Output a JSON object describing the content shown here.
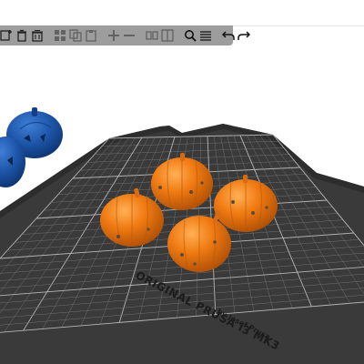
{
  "window": {
    "title": ""
  },
  "toolbar": {
    "items": [
      {
        "name": "add-icon",
        "enabled": true
      },
      {
        "name": "delete-icon",
        "enabled": true
      },
      {
        "name": "delete-all-icon",
        "enabled": true
      },
      {
        "name": "arrange-icon",
        "enabled": false
      },
      {
        "name": "copy-icon",
        "enabled": false
      },
      {
        "name": "paste-icon",
        "enabled": false
      },
      {
        "name": "add-instance-icon",
        "enabled": false
      },
      {
        "name": "remove-instance-icon",
        "enabled": false
      },
      {
        "name": "split-objects-icon",
        "enabled": false
      },
      {
        "name": "split-parts-icon",
        "enabled": false
      },
      {
        "name": "search-icon",
        "enabled": true
      },
      {
        "name": "layers-editing-icon",
        "enabled": true
      },
      {
        "name": "undo-icon",
        "enabled": true
      },
      {
        "name": "redo-icon",
        "enabled": true
      }
    ]
  },
  "bed": {
    "label_line1": "ORIGINAL PRUSA i3 MK3",
    "label_line2": "by Josef Prusa"
  },
  "scene": {
    "objects": [
      {
        "name": "pumpkin-1",
        "state": "selected",
        "color": "#f07a12"
      },
      {
        "name": "pumpkin-2",
        "state": "selected",
        "color": "#f07a12"
      },
      {
        "name": "pumpkin-3",
        "state": "selected",
        "color": "#f07a12"
      },
      {
        "name": "pumpkin-4",
        "state": "selected",
        "color": "#f07a12"
      },
      {
        "name": "pumpkin-outside-1",
        "state": "outside-bed",
        "color": "#1d55a8"
      },
      {
        "name": "pumpkin-outside-2",
        "state": "outside-bed",
        "color": "#1d55a8"
      }
    ]
  },
  "colors": {
    "background": "#ffffff",
    "bed": "#3a3a3a",
    "grid": "#8a8a8a",
    "selected_object": "#f07a12",
    "outside_object": "#1d55a8",
    "toolbar": "#8c8c8c"
  }
}
